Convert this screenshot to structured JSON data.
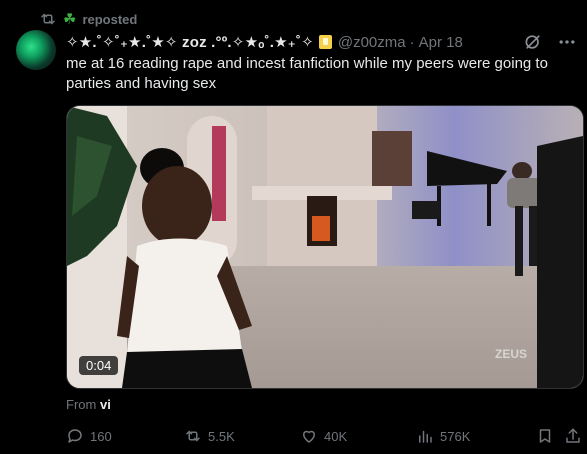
{
  "repost": {
    "label": "reposted"
  },
  "author": {
    "display_name": "✧★.˚✧˚₊★.˚★✧ zoz .°º.✧★ₒ˚.★₊˚✧",
    "handle": "@z00zma",
    "date": "Apr 18"
  },
  "tweet": {
    "text": "me at 16 reading rape and incest fanfiction while my peers were going to parties and having sex"
  },
  "media": {
    "duration": "0:04",
    "watermark": "ZEUS"
  },
  "source": {
    "prefix": "From",
    "name": "vi"
  },
  "actions": {
    "replies": "160",
    "reposts": "5.5K",
    "likes": "40K",
    "views": "576K"
  },
  "colors": {
    "muted": "#71767b",
    "text": "#e7e9ea",
    "background": "#000000",
    "clover": "#3cb043"
  }
}
